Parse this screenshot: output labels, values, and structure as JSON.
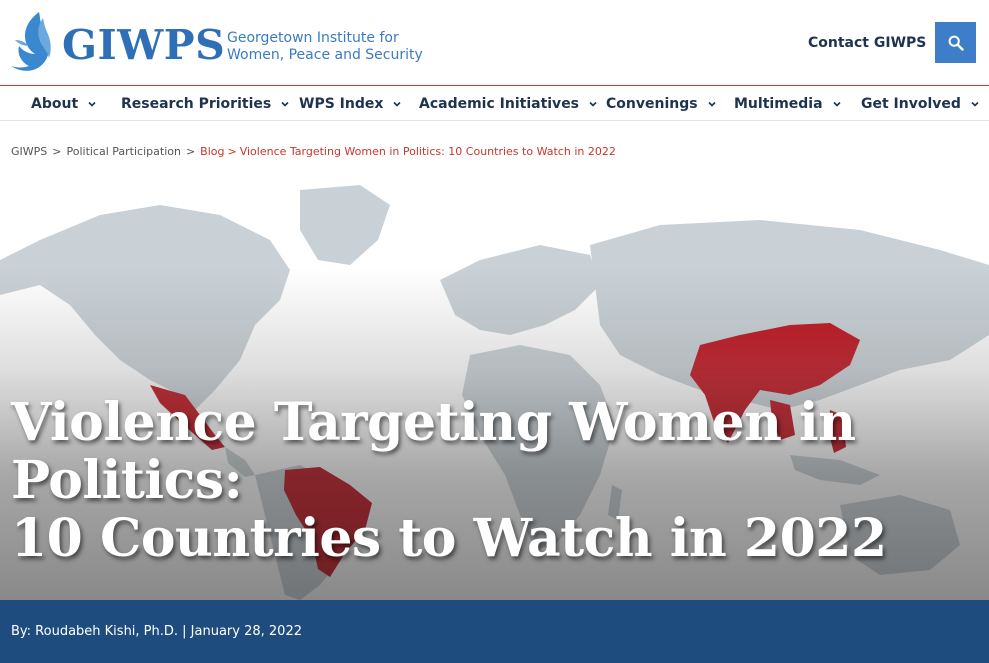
{
  "header": {
    "brand": "GIWPS",
    "subtitle_line1": "Georgetown Institute for",
    "subtitle_line2": "Women, Peace and Security",
    "contact_label": "Contact GIWPS",
    "search_icon": "search-icon"
  },
  "nav": {
    "items": [
      {
        "label": "About"
      },
      {
        "label": "Research Priorities"
      },
      {
        "label": "WPS Index"
      },
      {
        "label": "Academic Initiatives"
      },
      {
        "label": "Convenings"
      },
      {
        "label": "Multimedia"
      },
      {
        "label": "Get Involved"
      }
    ]
  },
  "breadcrumb": {
    "home": "GIWPS",
    "category": "Political Participation",
    "section": "Blog",
    "current": "Violence Targeting Women in Politics: 10 Countries to Watch in 2022",
    "separator": ">"
  },
  "hero": {
    "title_line1": "Violence Targeting Women in Politics:",
    "title_line2": "10 Countries to Watch in 2022"
  },
  "byline": {
    "text": "By: Roudabeh Kishi, Ph.D. | January 28, 2022"
  },
  "colors": {
    "brand_blue": "#2f6fb7",
    "nav_text": "#1d3350",
    "accent_red": "#c8372a",
    "byline_bg": "#1f4c7f",
    "map_land": "#c9d1d6",
    "map_highlight": "#c0111c"
  }
}
